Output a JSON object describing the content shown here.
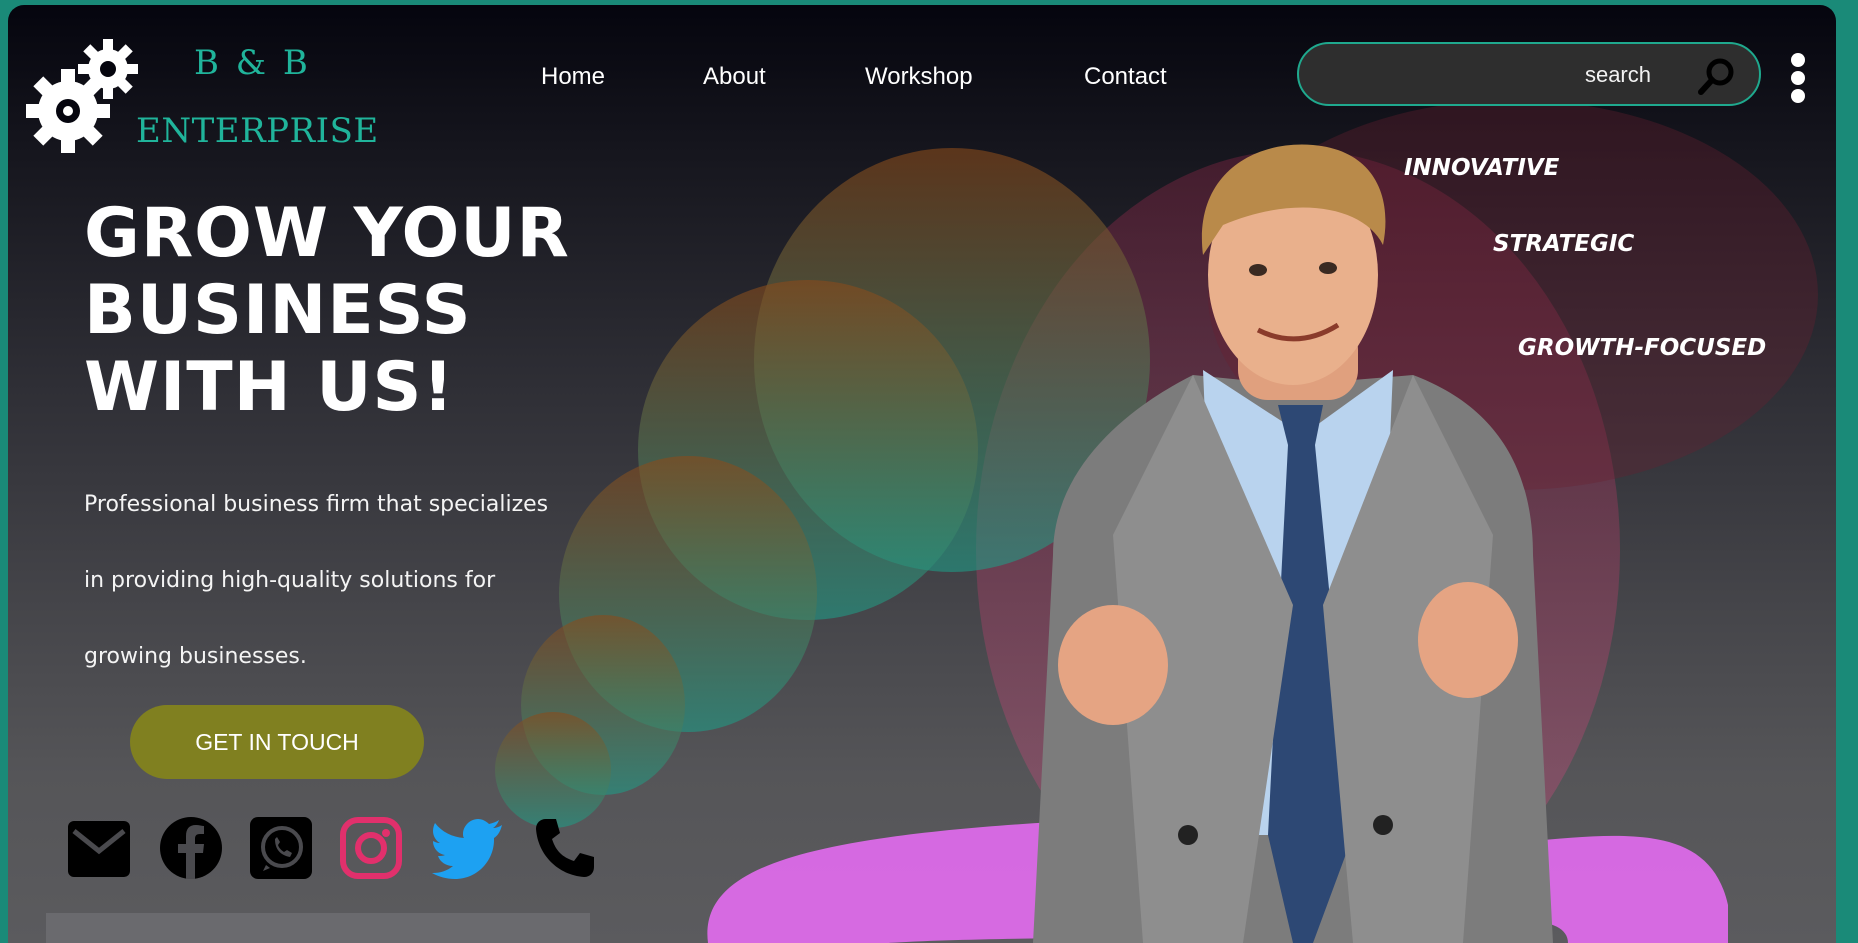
{
  "brand": {
    "line1": "B & B",
    "line2": "ENTERPRISE"
  },
  "nav": {
    "items": [
      "Home",
      "About",
      "Workshop",
      "Contact"
    ]
  },
  "search": {
    "placeholder": "search",
    "icon": "search-icon"
  },
  "menu": {
    "icon": "kebab-menu-icon"
  },
  "hero": {
    "title_lines": [
      "GROW YOUR",
      "BUSINESS",
      "WITH US!"
    ],
    "desc_lines": [
      "Professional business firm that specializes",
      "in providing high-quality solutions for",
      "growing businesses."
    ],
    "cta_label": "GET IN TOUCH"
  },
  "taglines": [
    "INNOVATIVE",
    "STRATEGIC",
    "GROWTH-FOCUSED"
  ],
  "social": {
    "icons": [
      "mail-icon",
      "facebook-icon",
      "whatsapp-icon",
      "instagram-icon",
      "twitter-icon",
      "phone-icon"
    ],
    "colors": {
      "instagram": "#e1306c",
      "twitter": "#1da1f2",
      "default": "#000000"
    }
  },
  "colors": {
    "accent": "#20b49b",
    "cta": "#808020",
    "frame_border": "#1a8a78",
    "pink_stroke": "#e36bf0"
  }
}
